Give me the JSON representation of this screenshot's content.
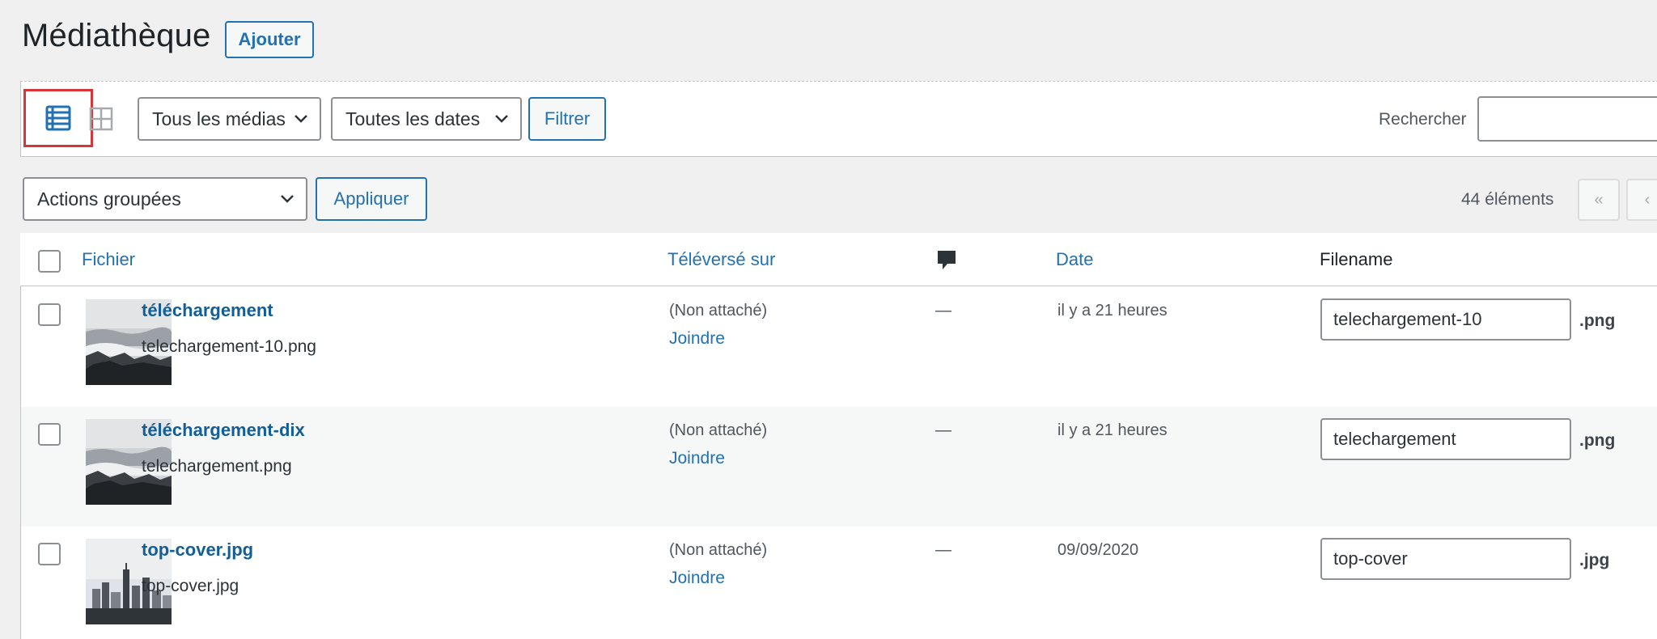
{
  "header": {
    "title": "Médiathèque",
    "add_label": "Ajouter"
  },
  "toolbar": {
    "media_filter": "Tous les médias",
    "date_filter": "Toutes les dates",
    "filter_label": "Filtrer",
    "search_label": "Rechercher",
    "search_value": ""
  },
  "bulk": {
    "actions_label": "Actions groupées",
    "apply_label": "Appliquer",
    "count": "44 éléments",
    "first_page": "«",
    "prev_page": "‹"
  },
  "table": {
    "columns": {
      "file": "Fichier",
      "uploaded_to": "Téléversé sur",
      "comments_icon": "comment-icon",
      "date": "Date",
      "filename": "Filename"
    },
    "rows": [
      {
        "title": "téléchargement",
        "file": "telechargement-10.png",
        "attached": "(Non attaché)",
        "attach_link": "Joindre",
        "comments": "—",
        "date": "il y a 21 heures",
        "filename_value": "telechargement-10",
        "ext": ".png",
        "thumb": "sea-icon"
      },
      {
        "title": "téléchargement-dix",
        "file": "telechargement.png",
        "attached": "(Non attaché)",
        "attach_link": "Joindre",
        "comments": "—",
        "date": "il y a 21 heures",
        "filename_value": "telechargement",
        "ext": ".png",
        "thumb": "sea-icon"
      },
      {
        "title": "top-cover.jpg",
        "file": "top-cover.jpg",
        "attached": "(Non attaché)",
        "attach_link": "Joindre",
        "comments": "—",
        "date": "09/09/2020",
        "filename_value": "top-cover",
        "ext": ".jpg",
        "thumb": "city-icon"
      }
    ]
  },
  "colors": {
    "accent": "#2271b1",
    "title_link": "#135e96",
    "highlight_border": "#d63638",
    "background": "#f0f0f1"
  }
}
